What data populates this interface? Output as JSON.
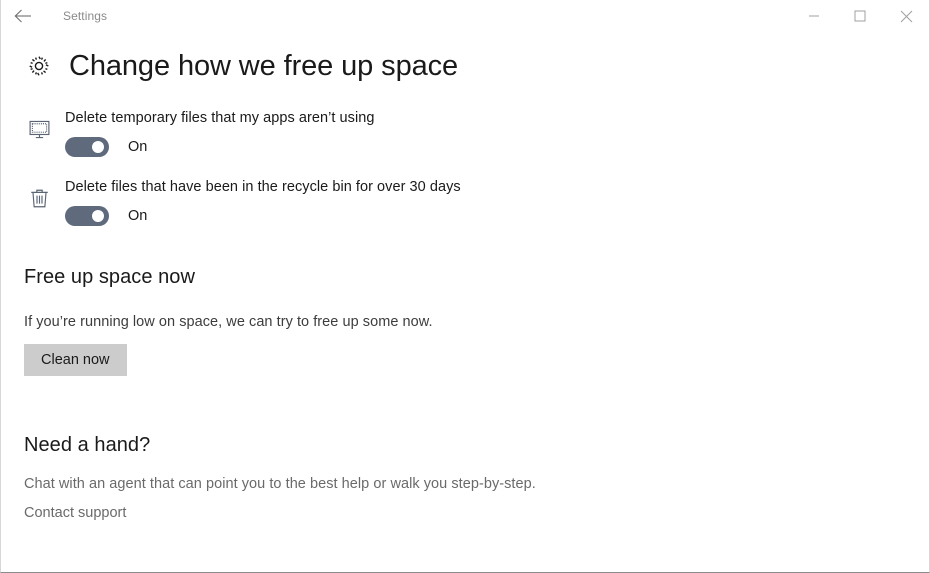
{
  "titlebar": {
    "back_icon": "back-arrow-icon",
    "app_title": "Settings",
    "minimize_label": "Minimize",
    "maximize_label": "Maximize",
    "close_label": "Close"
  },
  "header": {
    "icon": "gear-icon",
    "title": "Change how we free up space"
  },
  "settings": [
    {
      "icon": "monitor-icon",
      "label": "Delete temporary files that my apps aren’t using",
      "toggle_state": "On",
      "toggle_on": true
    },
    {
      "icon": "trash-icon",
      "label": "Delete files that have been in the recycle bin for over 30 days",
      "toggle_state": "On",
      "toggle_on": true
    }
  ],
  "free_up_space": {
    "heading": "Free up space now",
    "description": "If you’re running low on space, we can try to free up some now.",
    "button_label": "Clean now"
  },
  "need_a_hand": {
    "heading": "Need a hand?",
    "description": "Chat with an agent that can point you to the best help or walk you step-by-step.",
    "link_label": "Contact support"
  },
  "colors": {
    "toggle_on": "#5f6b7d",
    "button_face": "#cccccc",
    "text_primary": "#1a1a1a",
    "text_muted": "#6a6a6a",
    "window_bg": "#ffffff"
  }
}
